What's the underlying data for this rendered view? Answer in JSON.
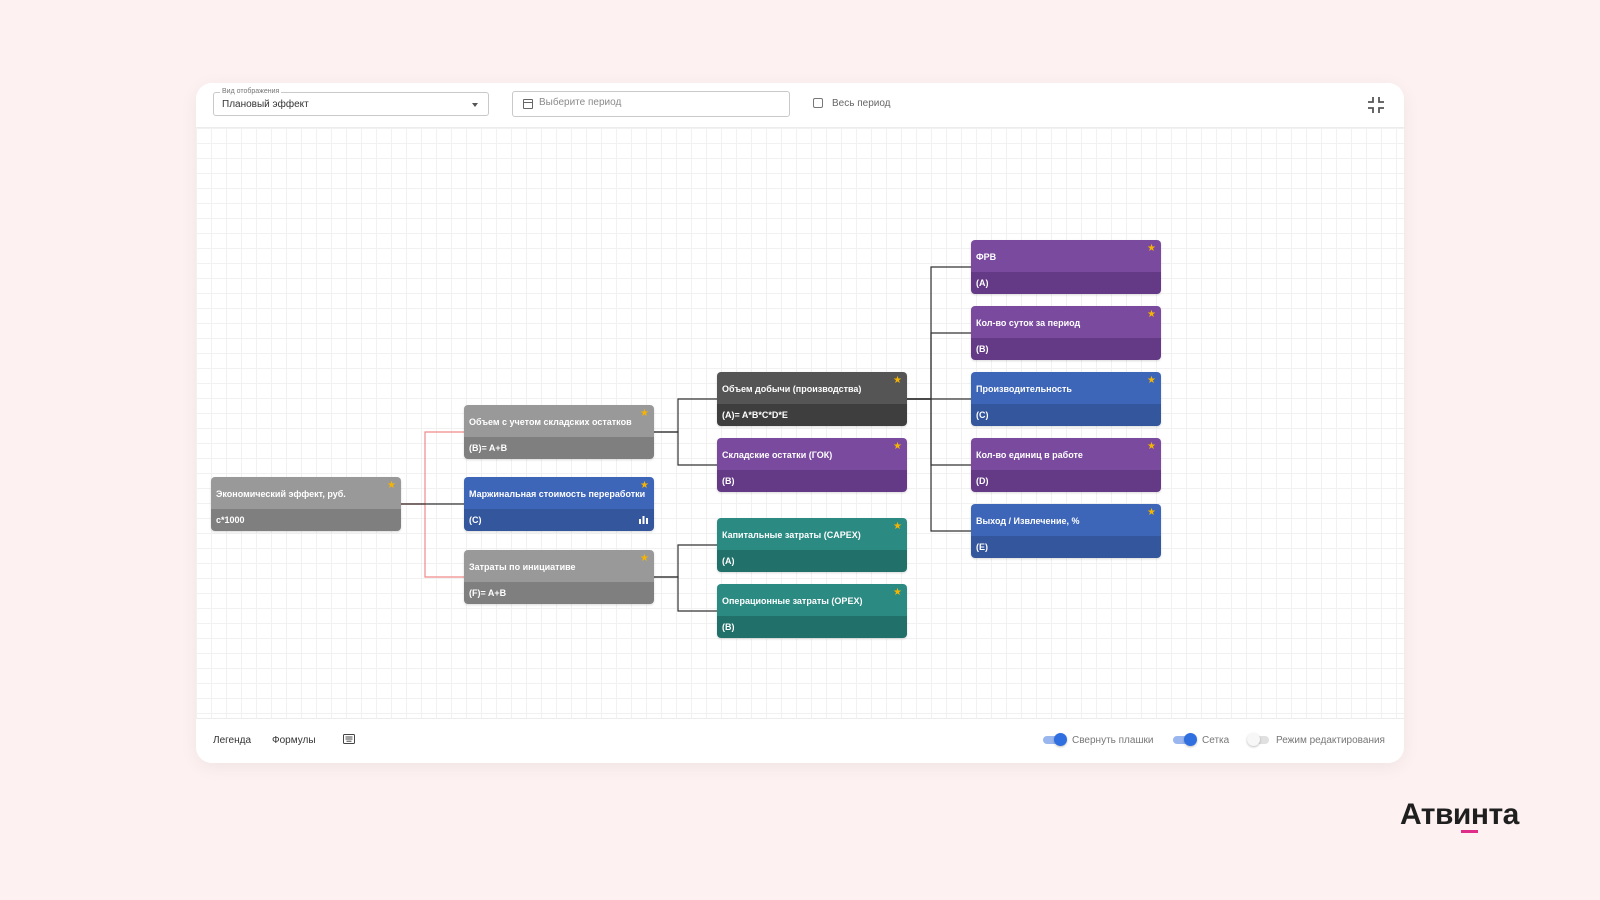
{
  "toolbar": {
    "view_legend": "Вид отображения",
    "view_value": "Плановый эффект",
    "period_placeholder": "Выберите период",
    "all_period_label": "Весь период"
  },
  "nodes": [
    {
      "id": "root",
      "title": "Экономический эффект, руб.",
      "formula": "с*1000",
      "color": "gray"
    },
    {
      "id": "volume-stock",
      "title": "Объем с учетом складских остатков",
      "formula": "(B)= A+B",
      "color": "gray"
    },
    {
      "id": "marginal-cost",
      "title": "Маржинальная стоимость переработки",
      "formula": "(C)",
      "color": "blue"
    },
    {
      "id": "initiative-costs",
      "title": "Затраты по инициативе",
      "formula": "(F)= A+B",
      "color": "gray"
    },
    {
      "id": "production-volume",
      "title": "Объем добычи (производства)",
      "formula": "(A)= A*B*C*D*E",
      "color": "dark"
    },
    {
      "id": "stock-gok",
      "title": "Складские остатки (ГОК)",
      "formula": "(B)",
      "color": "purple"
    },
    {
      "id": "capex",
      "title": "Капитальные затраты (CAPEX)",
      "formula": "(A)",
      "color": "teal"
    },
    {
      "id": "opex",
      "title": "Операционные затраты (OPEX)",
      "formula": "(B)",
      "color": "teal"
    },
    {
      "id": "frv",
      "title": "ФРВ",
      "formula": "(A)",
      "color": "purple"
    },
    {
      "id": "days",
      "title": "Кол-во суток за период",
      "formula": "(B)",
      "color": "purple"
    },
    {
      "id": "productivity",
      "title": "Производительность",
      "formula": "(C)",
      "color": "blue"
    },
    {
      "id": "units",
      "title": "Кол-во единиц в работе",
      "formula": "(D)",
      "color": "purple"
    },
    {
      "id": "yield",
      "title": "Выход / Извлечение, %",
      "formula": "(E)",
      "color": "blue"
    }
  ],
  "footer": {
    "legend_tab": "Легенда",
    "formulas_tab": "Формулы",
    "toggles": [
      {
        "label": "Свернуть плашки",
        "on": true
      },
      {
        "label": "Сетка",
        "on": true
      },
      {
        "label": "Режим редактирования",
        "on": false
      }
    ]
  },
  "brand": "Атвинта",
  "colors": {
    "gray": "#999999",
    "dark": "#555555",
    "blue": "#3d65b8",
    "purple": "#7a4a9e",
    "teal": "#2b8a82",
    "star": "#f5b400",
    "toggle_on": "#2f6fe0",
    "link": "#333333",
    "link_highlight": "#f08a8a",
    "brand_accent": "#e02d8a"
  }
}
